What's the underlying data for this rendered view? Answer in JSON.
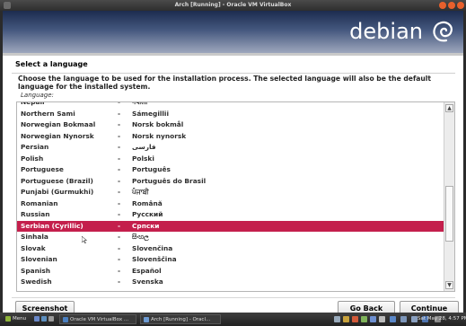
{
  "window": {
    "title": "Arch [Running] - Oracle VM VirtualBox"
  },
  "installer": {
    "logo_text": "debian",
    "section_title": "Select a language",
    "instruction": "Choose the language to be used for the installation process. The selected language will also be the default language for the installed system.",
    "list_label": "Language:",
    "languages": [
      {
        "en": "Nepali",
        "native": "नेपाली"
      },
      {
        "en": "Northern Sami",
        "native": "Sámegillii"
      },
      {
        "en": "Norwegian Bokmaal",
        "native": "Norsk bokmål"
      },
      {
        "en": "Norwegian Nynorsk",
        "native": "Norsk nynorsk"
      },
      {
        "en": "Persian",
        "native": "فارسی"
      },
      {
        "en": "Polish",
        "native": "Polski"
      },
      {
        "en": "Portuguese",
        "native": "Português"
      },
      {
        "en": "Portuguese (Brazil)",
        "native": "Português do Brasil"
      },
      {
        "en": "Punjabi (Gurmukhi)",
        "native": "ਪੰਜਾਬੀ"
      },
      {
        "en": "Romanian",
        "native": "Română"
      },
      {
        "en": "Russian",
        "native": "Русский"
      },
      {
        "en": "Serbian (Cyrillic)",
        "native": "Српски"
      },
      {
        "en": "Sinhala",
        "native": "සිංහල"
      },
      {
        "en": "Slovak",
        "native": "Slovenčina"
      },
      {
        "en": "Slovenian",
        "native": "Slovenščina"
      },
      {
        "en": "Spanish",
        "native": "Español"
      },
      {
        "en": "Swedish",
        "native": "Svenska"
      }
    ],
    "selected_language": "Serbian (Cyrillic)",
    "separator": "-",
    "buttons": {
      "screenshot": "Screenshot",
      "go_back": "Go Back",
      "continue": "Continue"
    }
  },
  "taskbar": {
    "menu": "Menu",
    "task1": "Oracle VM VirtualBox ...",
    "task2": "Arch [Running] - Oracl...",
    "clock": "Sat May 28, 4:57 PM"
  },
  "colors": {
    "selection": "#c41f4c",
    "banner_top": "#1c2c4f",
    "banner_bottom": "#9ea7bd"
  },
  "icons": [
    "menu-icon",
    "minimize-icon",
    "maximize-icon",
    "close-icon",
    "scroll-up-icon",
    "scroll-down-icon",
    "mouse-pointer-icon",
    "virtualbox-icon",
    "window-icon"
  ]
}
